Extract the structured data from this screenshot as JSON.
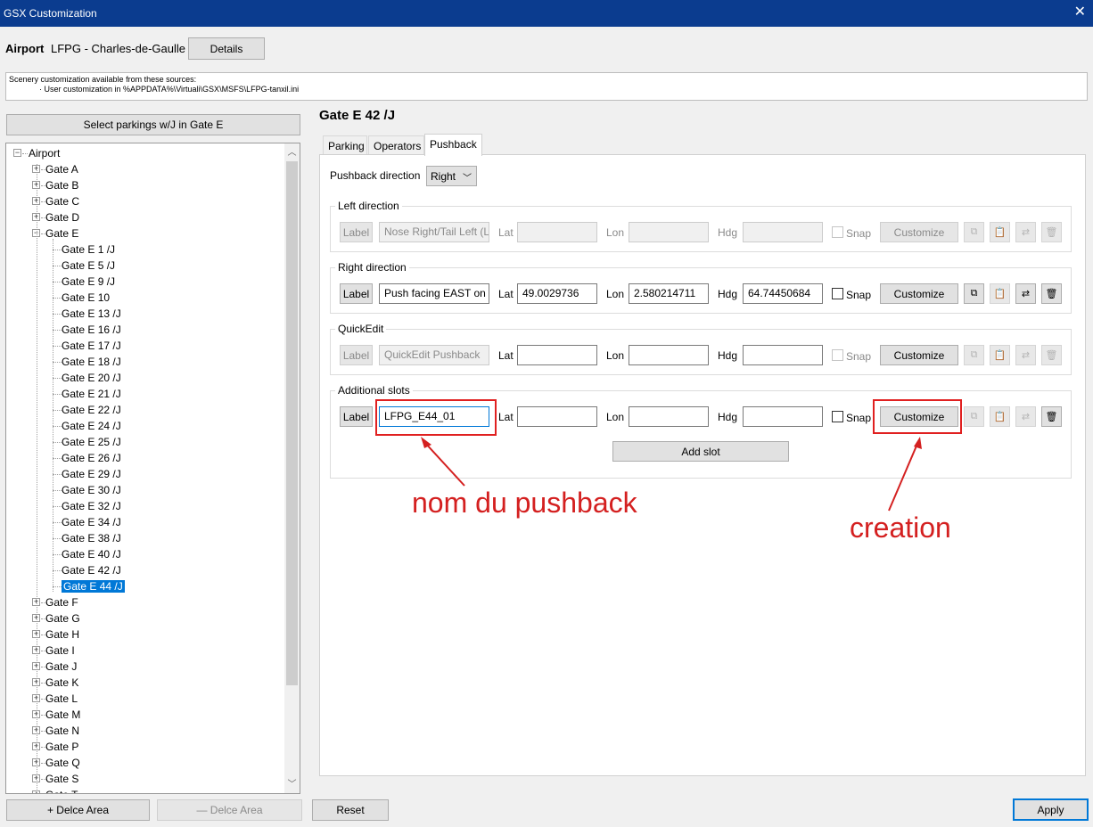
{
  "window": {
    "title": "GSX Customization",
    "close_glyph": "✕"
  },
  "airport": {
    "label": "Airport",
    "name": "LFPG - Charles-de-Gaulle",
    "details_button": "Details"
  },
  "sources": {
    "line1": "Scenery customization available from these sources:",
    "line2": "· User customization in %APPDATA%\\Virtuali\\GSX\\MSFS\\LFPG-tanxil.ini"
  },
  "left": {
    "select_button": "Select parkings w/J in Gate E",
    "tree": {
      "root": "Airport",
      "gates_before": [
        "Gate A",
        "Gate B",
        "Gate C",
        "Gate D"
      ],
      "expanded_gate": "Gate E",
      "children": [
        "Gate E 1 /J",
        "Gate E 5 /J",
        "Gate E 9 /J",
        "Gate E 10",
        "Gate E 13 /J",
        "Gate E 16 /J",
        "Gate E 17 /J",
        "Gate E 18 /J",
        "Gate E 20 /J",
        "Gate E 21 /J",
        "Gate E 22 /J",
        "Gate E 24 /J",
        "Gate E 25 /J",
        "Gate E 26 /J",
        "Gate E 29 /J",
        "Gate E 30 /J",
        "Gate E 32 /J",
        "Gate E 34 /J",
        "Gate E 38 /J",
        "Gate E 40 /J",
        "Gate E 42 /J",
        "Gate E 44 /J"
      ],
      "selected": "Gate E 44 /J",
      "gates_after": [
        "Gate F",
        "Gate G",
        "Gate H",
        "Gate I",
        "Gate J",
        "Gate K",
        "Gate L",
        "Gate M",
        "Gate N",
        "Gate P",
        "Gate Q",
        "Gate S",
        "Gate T"
      ]
    },
    "add_area_button": "+ Delce Area",
    "remove_area_button": "— Delce Area"
  },
  "right": {
    "gate_title": "Gate E 42 /J",
    "tabs": [
      "Parking",
      "Operators",
      "Pushback"
    ],
    "active_tab": "Pushback",
    "pushback_direction_label": "Pushback direction",
    "pushback_direction_value": "Right",
    "field_labels": {
      "label": "Label",
      "lat": "Lat",
      "lon": "Lon",
      "hdg": "Hdg",
      "snap": "Snap",
      "customize": "Customize"
    },
    "groups": [
      {
        "title": "Left direction",
        "label_value": "Nose Right/Tail Left (L",
        "lat": "",
        "lon": "",
        "hdg": "",
        "enabled": false
      },
      {
        "title": "Right direction",
        "label_value": "Push facing EAST on F",
        "lat": "49.0029736",
        "lon": "2.580214711",
        "hdg": "64.74450684",
        "enabled": true
      },
      {
        "title": "QuickEdit",
        "label_value": "QuickEdit Pushback",
        "lat": "",
        "lon": "",
        "hdg": "",
        "enabled": false
      },
      {
        "title": "Additional slots",
        "label_value": "LFPG_E44_01",
        "lat": "",
        "lon": "",
        "hdg": "",
        "enabled": true
      }
    ],
    "add_slot_button": "Add slot"
  },
  "bottom": {
    "reset_button": "Reset",
    "apply_button": "Apply"
  },
  "annotations": {
    "name_note": "nom du pushback",
    "create_note": "creation",
    "color": "#d42020"
  }
}
